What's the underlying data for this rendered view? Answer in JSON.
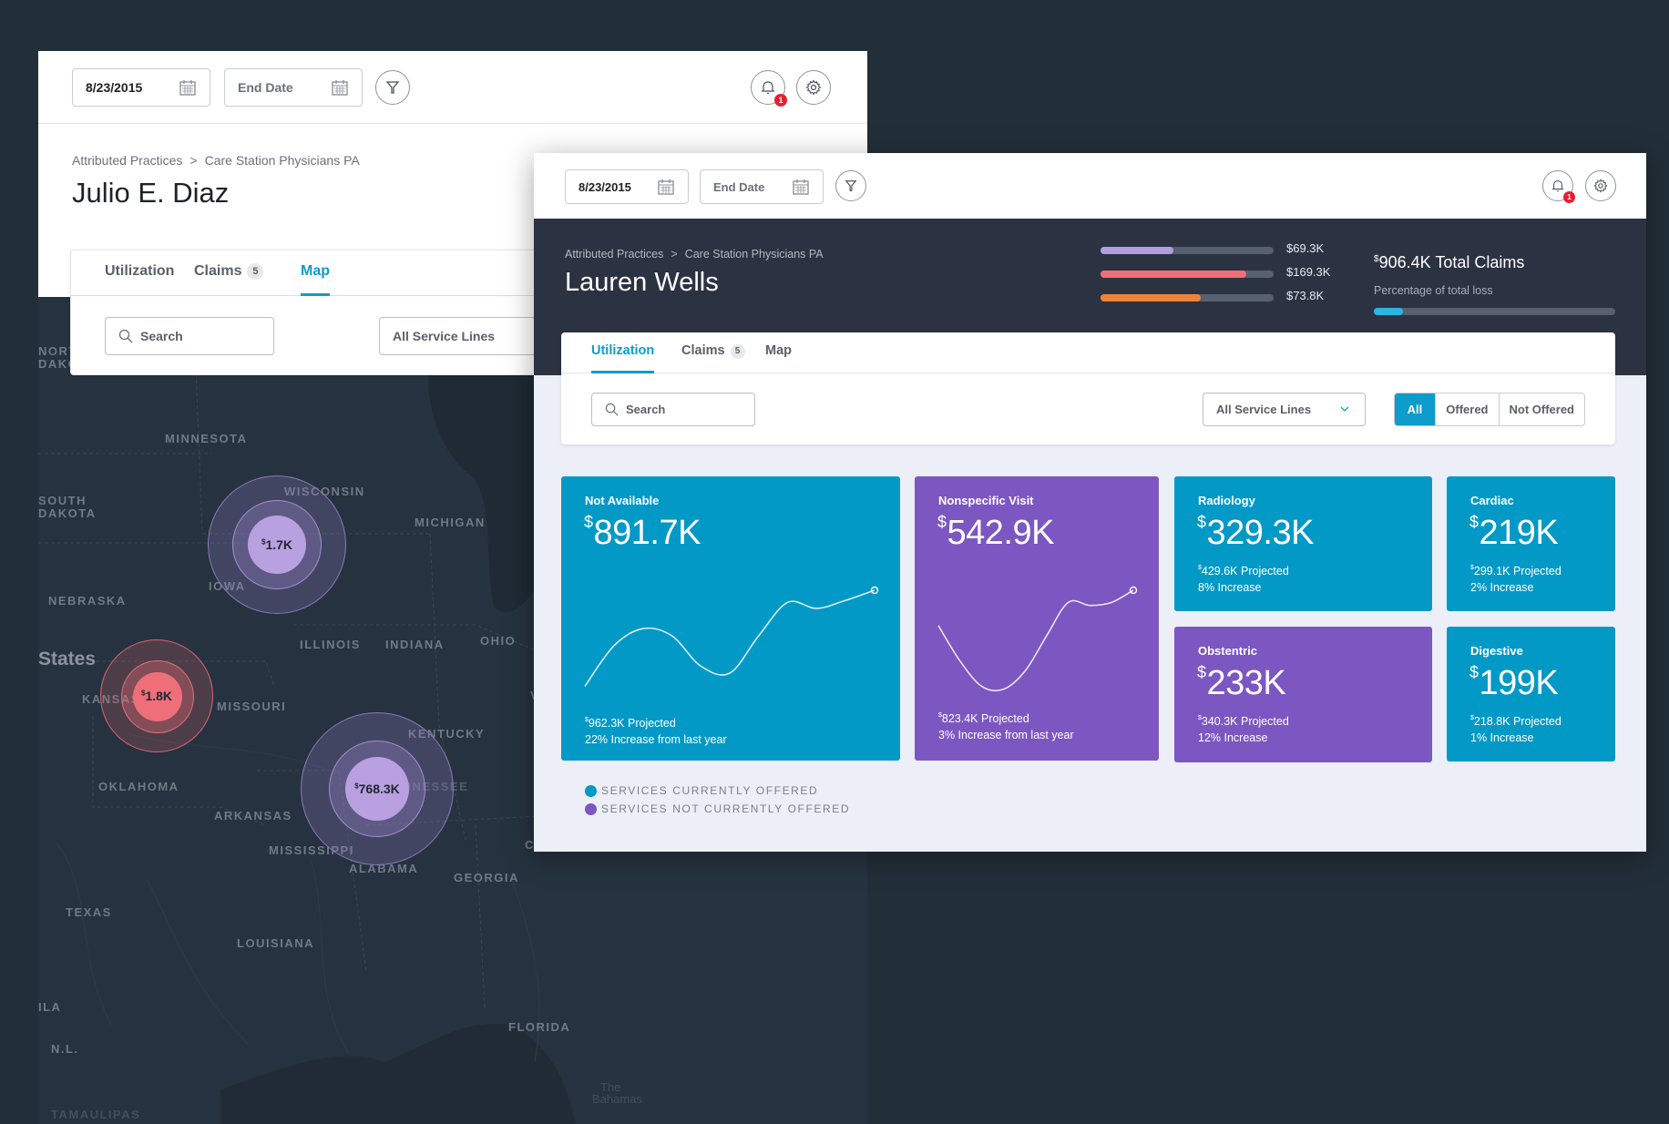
{
  "back_window": {
    "start_date": "8/23/2015",
    "end_date_placeholder": "End Date",
    "notification_count": "1",
    "breadcrumb": [
      "Attributed Practices",
      "Care Station Physicians PA"
    ],
    "breadcrumb_separator": ">",
    "person_name": "Julio E. Diaz",
    "tabs": [
      {
        "label": "Utilization",
        "active": false
      },
      {
        "label": "Claims",
        "count": "5",
        "active": false
      },
      {
        "label": "Map",
        "active": true
      }
    ],
    "search_placeholder": "Search",
    "service_lines_selected": "All Service Lines",
    "map": {
      "labels": [
        {
          "text": "NORTH",
          "kind": "state"
        },
        {
          "text": "DAKOTA",
          "kind": "state"
        },
        {
          "text": "MINNESOTA",
          "kind": "state"
        },
        {
          "text": "SOUTH",
          "kind": "state"
        },
        {
          "text": "DAKOTA",
          "kind": "state"
        },
        {
          "text": "WISCONSIN",
          "kind": "state"
        },
        {
          "text": "MICHIGAN",
          "kind": "state"
        },
        {
          "text": "IOWA",
          "kind": "state"
        },
        {
          "text": "NEBRASKA",
          "kind": "state"
        },
        {
          "text": "States",
          "kind": "country"
        },
        {
          "text": "ILLINOIS",
          "kind": "state"
        },
        {
          "text": "INDIANA",
          "kind": "state"
        },
        {
          "text": "OHIO",
          "kind": "state"
        },
        {
          "text": "KANSAS",
          "kind": "state"
        },
        {
          "text": "MISSOURI",
          "kind": "state"
        },
        {
          "text": "KENTUCKY",
          "kind": "state"
        },
        {
          "text": "OKLAHOMA",
          "kind": "state"
        },
        {
          "text": "ARKANSAS",
          "kind": "state"
        },
        {
          "text": "TENNESSEE",
          "kind": "state"
        },
        {
          "text": "MISSISSIPPI",
          "kind": "state"
        },
        {
          "text": "ALABAMA",
          "kind": "state"
        },
        {
          "text": "GEORGIA",
          "kind": "state"
        },
        {
          "text": "TEXAS",
          "kind": "state"
        },
        {
          "text": "LOUISIANA",
          "kind": "state"
        },
        {
          "text": "FLORIDA",
          "kind": "state"
        },
        {
          "text": "ILA",
          "kind": "state"
        },
        {
          "text": "N.L.",
          "kind": "state"
        },
        {
          "text": "TAMAULIPAS",
          "kind": "state"
        },
        {
          "text": "The",
          "kind": "place"
        },
        {
          "text": "Bahamas",
          "kind": "place"
        },
        {
          "text": "W",
          "kind": "state"
        },
        {
          "text": "VIR",
          "kind": "state"
        },
        {
          "text": "CA",
          "kind": "state"
        }
      ],
      "markers": [
        {
          "currency": "$",
          "value": "1.7K",
          "color": "#b9a0e0",
          "ring_color": "#8a78b8"
        },
        {
          "currency": "$",
          "value": "1.8K",
          "color": "#ef6f79",
          "ring_color": "#d96470"
        },
        {
          "currency": "$",
          "value": "768.3K",
          "color": "#b9a0e0",
          "ring_color": "#8a78b8"
        }
      ]
    }
  },
  "front_window": {
    "start_date": "8/23/2015",
    "end_date_placeholder": "End Date",
    "notification_count": "1",
    "breadcrumb": [
      "Attributed Practices",
      "Care Station Physicians PA"
    ],
    "breadcrumb_separator": ">",
    "person_name": "Lauren Wells",
    "bars": [
      {
        "label": "$69.3K",
        "fraction": 0.42,
        "color": "#b39ddf"
      },
      {
        "label": "$169.3K",
        "fraction": 0.84,
        "color": "#ef6f79"
      },
      {
        "label": "$73.8K",
        "fraction": 0.58,
        "color": "#ee843a"
      }
    ],
    "total_claims": {
      "currency": "$",
      "value": "906.4K",
      "label": "Total Claims"
    },
    "loss_label": "Percentage of total loss",
    "loss_fraction": 0.12,
    "tabs": [
      {
        "label": "Utilization",
        "active": true
      },
      {
        "label": "Claims",
        "count": "5",
        "active": false
      },
      {
        "label": "Map",
        "active": false
      }
    ],
    "search_placeholder": "Search",
    "service_lines_selected": "All Service Lines",
    "segments": [
      {
        "label": "All",
        "active": true
      },
      {
        "label": "Offered",
        "active": false
      },
      {
        "label": "Not Offered",
        "active": false
      }
    ],
    "cards": [
      {
        "title": "Not Available",
        "currency": "$",
        "value": "891.7K",
        "projected": "962.3K Projected",
        "increase": "22% Increase from last year",
        "offered": true,
        "has_sparkline": true,
        "sparkline": [
          0.05,
          0.45,
          0.62,
          0.55,
          0.25,
          0.18,
          0.55,
          0.88,
          0.82,
          0.9,
          1.0
        ]
      },
      {
        "title": "Nonspecific Visit",
        "currency": "$",
        "value": "542.9K",
        "projected": "823.4K Projected",
        "increase": "3% Increase from last year",
        "offered": false,
        "has_sparkline": true,
        "sparkline": [
          0.65,
          0.3,
          0.05,
          0.02,
          0.2,
          0.55,
          0.88,
          0.85,
          0.88,
          1.0
        ]
      },
      {
        "title": "Radiology",
        "currency": "$",
        "value": "329.3K",
        "projected": "429.6K Projected",
        "increase": "8% Increase",
        "offered": true,
        "has_sparkline": false
      },
      {
        "title": "Cardiac",
        "currency": "$",
        "value": "219K",
        "projected": "299.1K Projected",
        "increase": "2% Increase",
        "offered": true,
        "has_sparkline": false
      },
      {
        "title": "Obstentric",
        "currency": "$",
        "value": "233K",
        "projected": "340.3K Projected",
        "increase": "12% Increase",
        "offered": false,
        "has_sparkline": false
      },
      {
        "title": "Digestive",
        "currency": "$",
        "value": "199K",
        "projected": "218.8K Projected",
        "increase": "1% Increase",
        "offered": true,
        "has_sparkline": false
      }
    ],
    "legend": [
      {
        "label": "SERVICES CURRENTLY OFFERED",
        "color": "#0399c7"
      },
      {
        "label": "SERVICES NOT CURRENTLY OFFERED",
        "color": "#7c57c1"
      }
    ]
  }
}
